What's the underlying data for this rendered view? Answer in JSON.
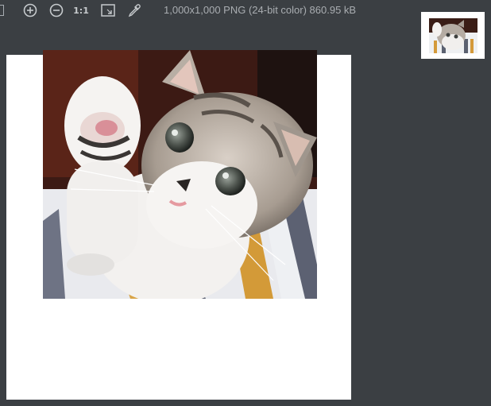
{
  "toolbar": {
    "zoom_in_icon": "plus-circle",
    "zoom_out_icon": "minus-circle",
    "actual_size_label": "1:1",
    "fit_icon": "fit-window",
    "color_picker_icon": "eyedropper"
  },
  "image_info": "1,000x1,000 PNG (24-bit color) 860.95 kB",
  "colors": {
    "background": "#3b3f43",
    "icon": "#c6cacd",
    "info_text": "#a9adb1",
    "canvas": "#ffffff"
  }
}
